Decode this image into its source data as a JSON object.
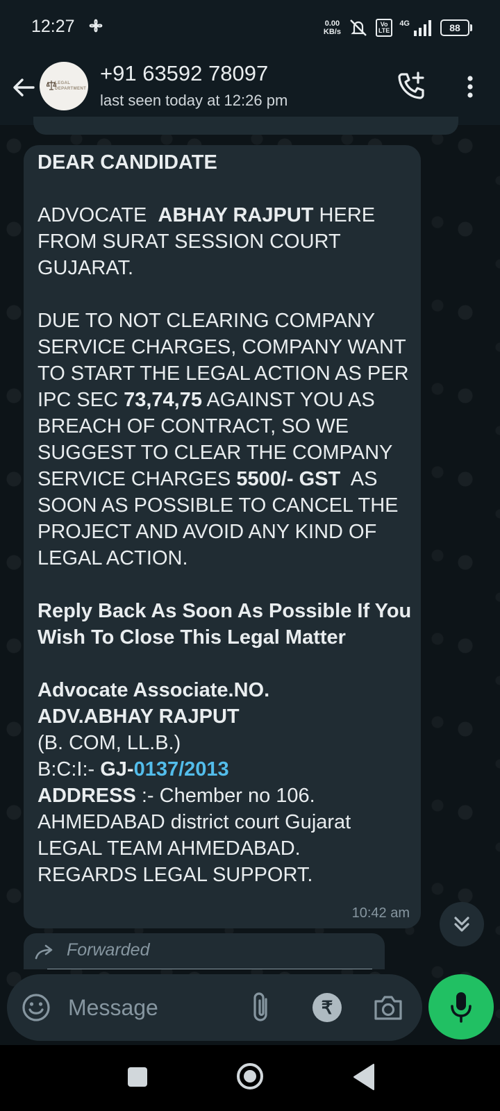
{
  "status_bar": {
    "time": "12:27",
    "data_rate_value": "0.00",
    "data_rate_unit": "KB/s",
    "volte_line1": "Vo",
    "volte_line2": "LTE",
    "network": "4G",
    "battery": "88"
  },
  "header": {
    "avatar_text_line1": "LEGAL",
    "avatar_text_line2": "DEPARTMENT",
    "contact_name": "+91 63592 78097",
    "last_seen": "last seen today at 12:26 pm"
  },
  "message": {
    "greeting": "DEAR CANDIDATE",
    "p1_a": "ADVOCATE  ",
    "p1_name": "ABHAY RAJPUT",
    "p1_b": " HERE FROM SURAT SESSION COURT GUJARAT.",
    "p2_a": "DUE TO NOT CLEARING COMPANY SERVICE CHARGES, COMPANY WANT TO START THE LEGAL ACTION AS PER IPC SEC ",
    "p2_sections": "73,74,75",
    "p2_b": " AGAINST YOU AS BREACH OF CONTRACT, SO WE SUGGEST TO CLEAR THE COMPANY SERVICE CHARGES ",
    "p2_amount": "5500/- GST",
    "p2_c": "  AS SOON AS POSSIBLE TO CANCEL THE PROJECT AND AVOID ANY KIND OF LEGAL ACTION.",
    "reply_line": "Reply Back As Soon As Possible If You Wish To Close This Legal Matter",
    "sig_assoc": "Advocate Associate.NO.",
    "sig_name": "ADV.ABHAY RAJPUT",
    "sig_degree": "(B. COM, LL.B.)",
    "bci_label": "B:C:I:- ",
    "bci_prefix": "GJ-",
    "bci_number": "0137/2013",
    "address_label": "ADDRESS",
    "address_value": " :- Chember no 106.",
    "address_line2": "AHMEDABAD district court Gujarat",
    "address_line3": "LEGAL TEAM AHMEDABAD.",
    "address_line4": "REGARDS LEGAL SUPPORT.",
    "time": "10:42 am"
  },
  "forwarded": {
    "label": "Forwarded"
  },
  "input": {
    "placeholder": "Message",
    "rupee_symbol": "₹"
  },
  "colors": {
    "accent_green": "#21c063",
    "link_blue": "#53bdeb",
    "bubble_bg": "#202c33",
    "header_bg": "#111b21"
  },
  "icons": [
    "fan-icon",
    "mute-icon",
    "signal-icon",
    "back-arrow-icon",
    "call-add-icon",
    "more-vert-icon",
    "forward-icon",
    "scroll-down-icon",
    "emoji-icon",
    "attach-icon",
    "rupee-icon",
    "camera-icon",
    "mic-icon"
  ]
}
